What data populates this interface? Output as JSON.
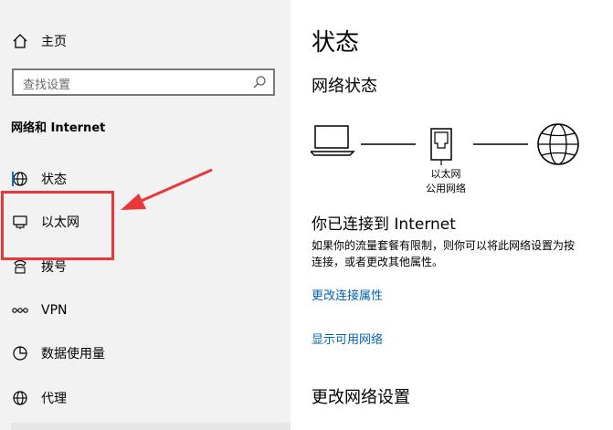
{
  "sidebar": {
    "home_label": "主页",
    "search_placeholder": "查找设置",
    "section_title": "网络和 Internet",
    "items": [
      {
        "label": "状态",
        "icon": "status-globe-icon"
      },
      {
        "label": "以太网",
        "icon": "ethernet-icon"
      },
      {
        "label": "拨号",
        "icon": "dialup-icon"
      },
      {
        "label": "VPN",
        "icon": "vpn-icon"
      },
      {
        "label": "数据使用量",
        "icon": "data-usage-icon"
      },
      {
        "label": "代理",
        "icon": "proxy-globe-icon"
      }
    ]
  },
  "main": {
    "title": "状态",
    "network_status_title": "网络状态",
    "network_name": "以太网",
    "network_type": "公用网络",
    "connected_title": "你已连接到 Internet",
    "connected_desc_line1": "如果你的流量套餐有限制，则你可以将此网络设置为按",
    "connected_desc_line2": "连接，或者更改其他属性。",
    "link_change_props": "更改连接属性",
    "link_show_networks": "显示可用网络",
    "change_settings_title": "更改网络设置"
  },
  "colors": {
    "sidebar_bg": "#f2f2f2",
    "link": "#0063b1",
    "annotation": "#e8383b"
  }
}
